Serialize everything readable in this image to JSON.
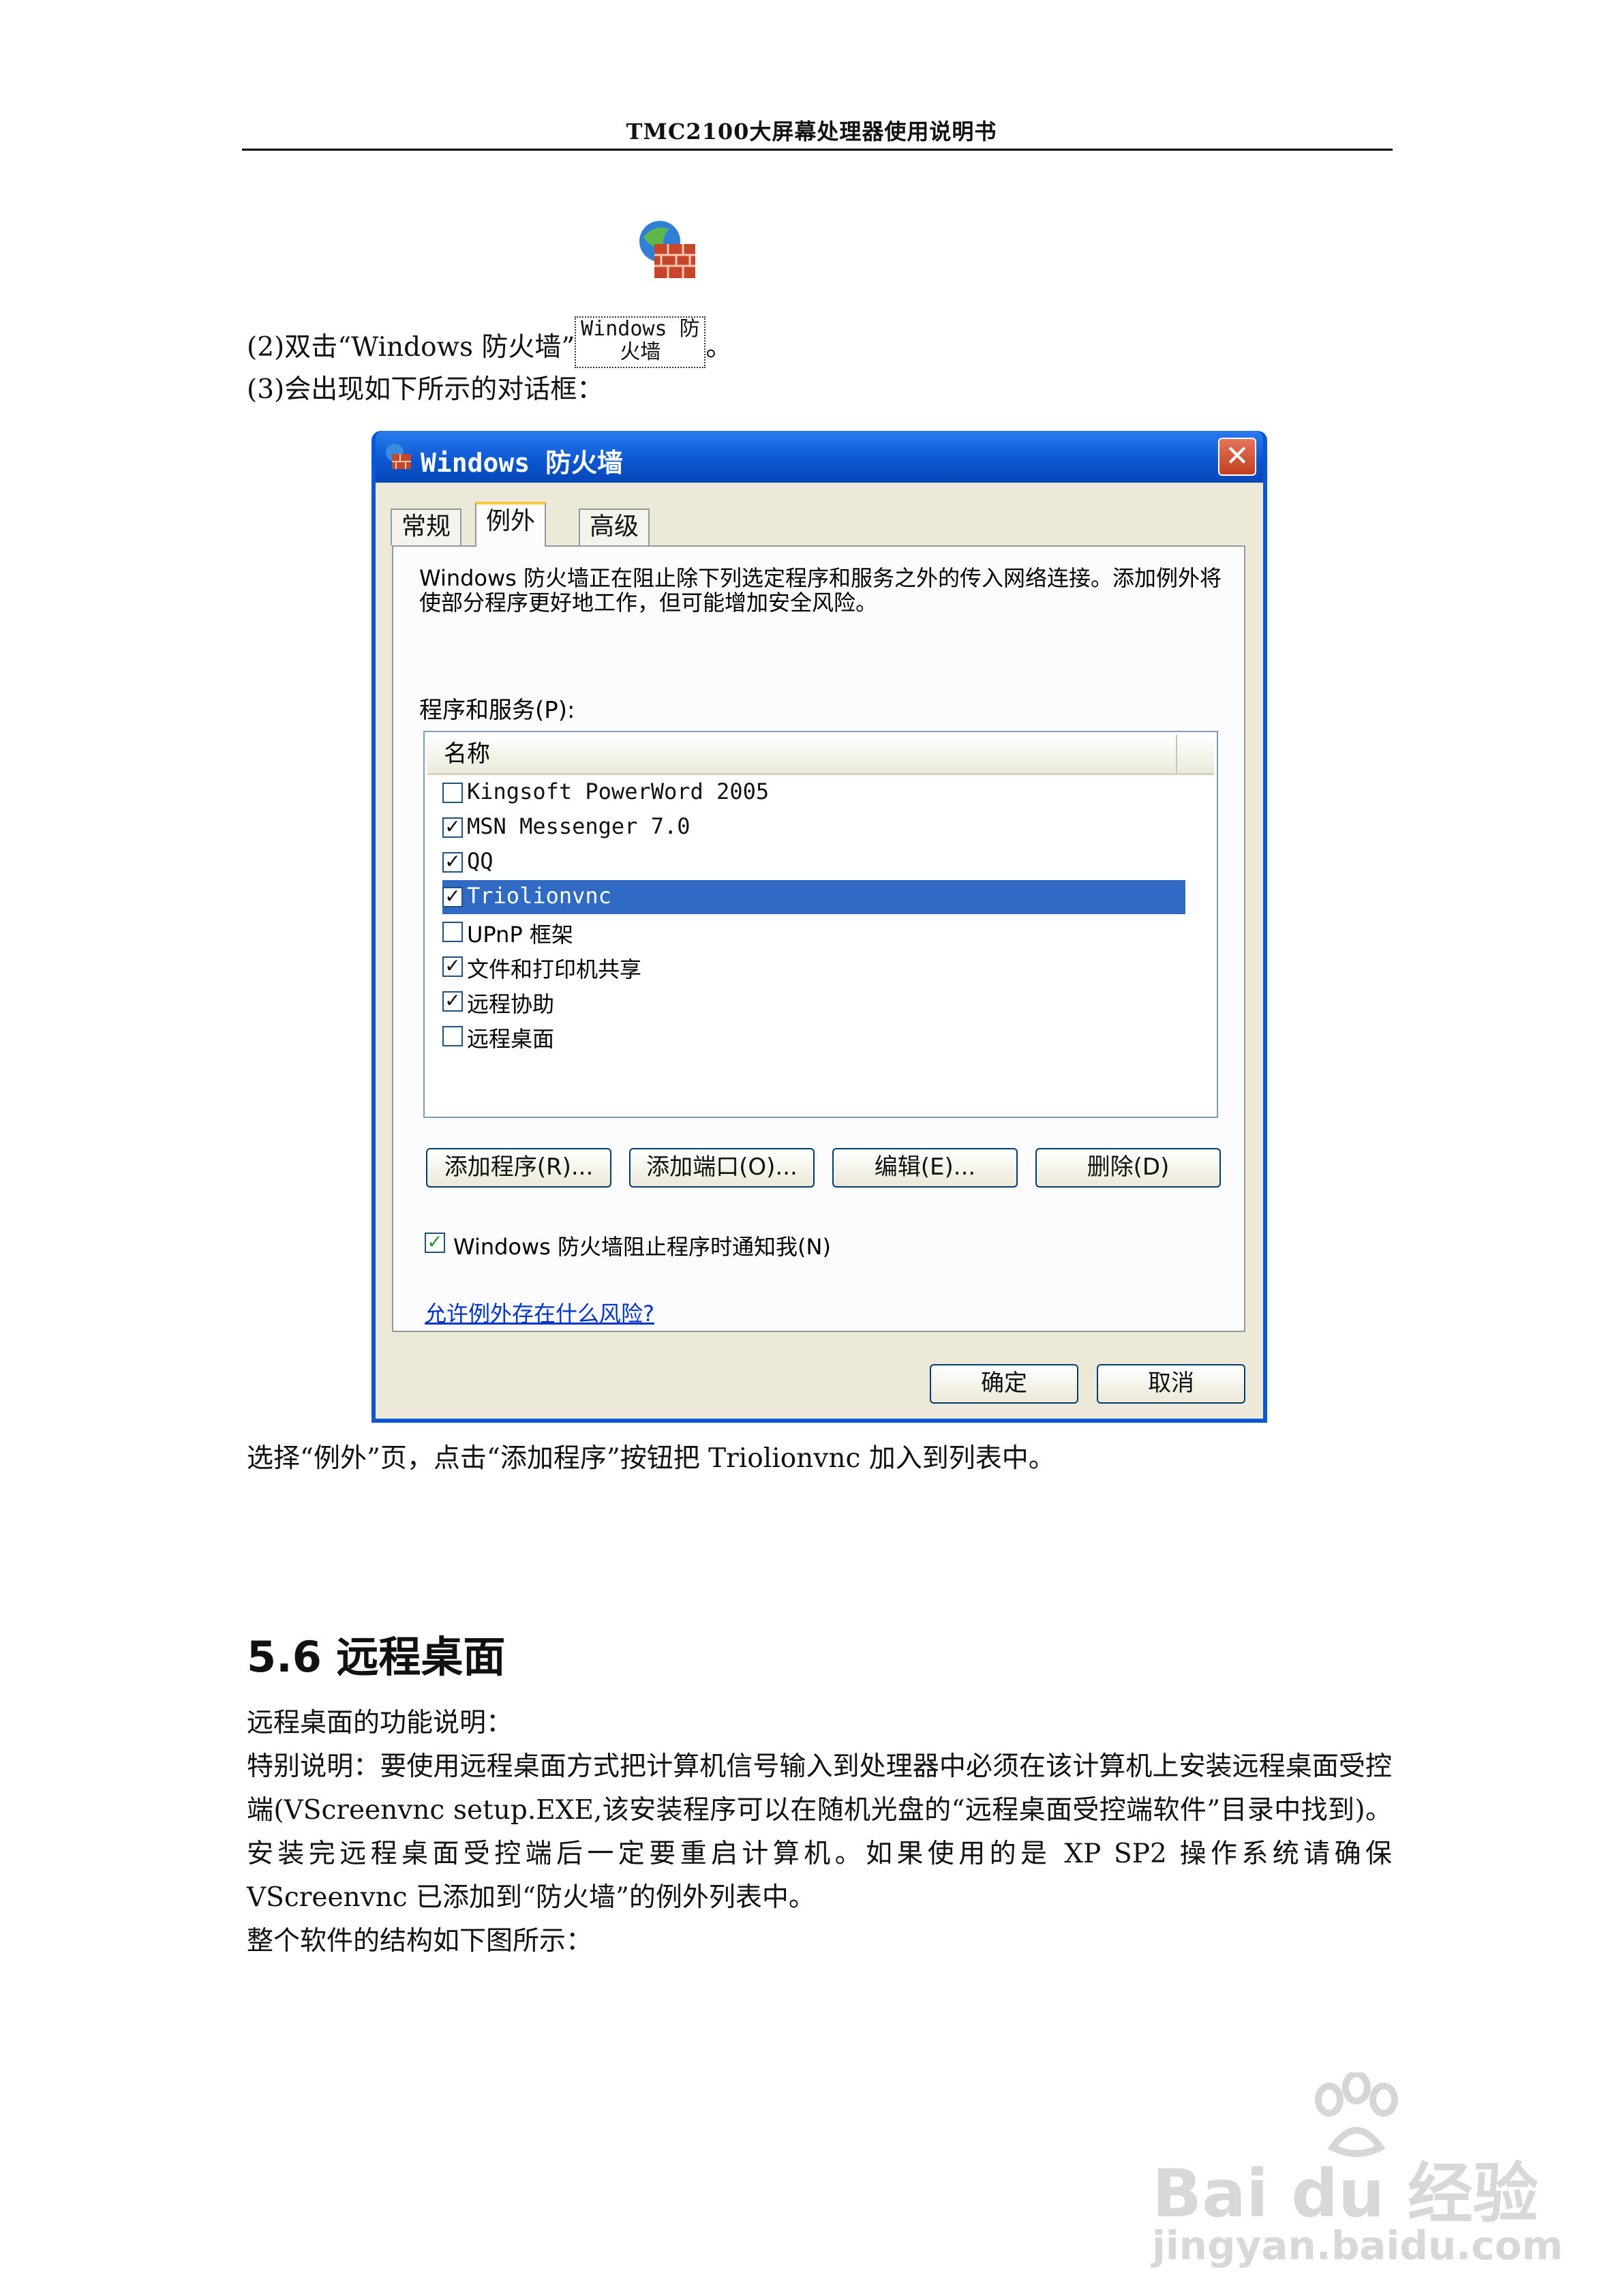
{
  "header": {
    "title": "TMC2100大屏幕处理器使用说明书"
  },
  "steps": {
    "step2_prefix": "(2)双击“Windows 防火墙”",
    "step2_icon_label_line1": "Windows 防",
    "step2_icon_label_line2": "火墙",
    "step2_suffix": "。",
    "step3": "(3)会出现如下所示的对话框："
  },
  "dialog": {
    "title": "Windows 防火墙",
    "close_glyph": "✕",
    "tabs": [
      "常规",
      "例外",
      "高级"
    ],
    "active_tab": "例外",
    "description": "Windows 防火墙正在阻止除下列选定程序和服务之外的传入网络连接。添加例外将使部分程序更好地工作，但可能增加安全风险。",
    "list_label": "程序和服务(P):",
    "list_column": "名称",
    "programs": [
      {
        "name": "Kingsoft PowerWord 2005",
        "checked": false,
        "selected": false
      },
      {
        "name": "MSN Messenger 7.0",
        "checked": true,
        "selected": false
      },
      {
        "name": "QQ",
        "checked": true,
        "selected": false
      },
      {
        "name": "Triolionvnc",
        "checked": true,
        "selected": true
      },
      {
        "name": "UPnP 框架",
        "checked": false,
        "selected": false
      },
      {
        "name": "文件和打印机共享",
        "checked": true,
        "selected": false
      },
      {
        "name": "远程协助",
        "checked": true,
        "selected": false
      },
      {
        "name": "远程桌面",
        "checked": false,
        "selected": false
      }
    ],
    "buttons": {
      "add_program": "添加程序(R)...",
      "add_port": "添加端口(O)...",
      "edit": "编辑(E)...",
      "delete": "删除(D)"
    },
    "notify_label": "Windows 防火墙阻止程序时通知我(N)",
    "notify_checked": true,
    "risk_link": "允许例外存在什么风险?",
    "ok": "确定",
    "cancel": "取消"
  },
  "body": {
    "after_dialog": "选择“例外”页，点击“添加程序”按钮把 Triolionvnc 加入到列表中。",
    "section_title": "5.6 远程桌面",
    "p1": "远程桌面的功能说明：",
    "p2": "特别说明：要使用远程桌面方式把计算机信号输入到处理器中必须在该计算机上安装远程桌面受控端(VScreenvnc setup.EXE,该安装程序可以在随机光盘的“远程桌面受控端软件”目录中找到)。安装完远程桌面受控端后一定要重启计算机。如果使用的是 XP SP2 操作系统请确保 VScreenvnc 已添加到“防火墙”的例外列表中。",
    "p3": "整个软件的结构如下图所示："
  },
  "watermark": {
    "brand": "Bai du 经验",
    "url": "jingyan.baidu.com"
  }
}
